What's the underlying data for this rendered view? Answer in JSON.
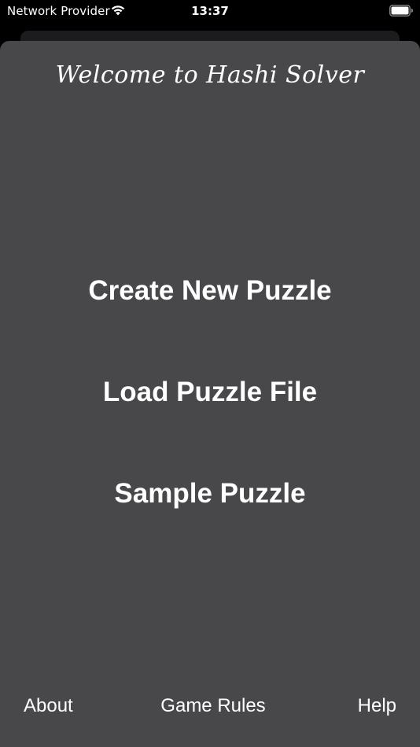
{
  "status_bar": {
    "carrier": "Network Provider",
    "time": "13:37",
    "wifi_icon": "wifi-icon",
    "battery_icon": "battery-icon"
  },
  "title": "Welcome to Hashi Solver",
  "menu": {
    "create_label": "Create New Puzzle",
    "load_label": "Load Puzzle File",
    "sample_label": "Sample Puzzle"
  },
  "footer": {
    "about_label": "About",
    "rules_label": "Game Rules",
    "help_label": "Help"
  },
  "colors": {
    "background": "#000000",
    "sheet": "#48484a",
    "text": "#ffffff"
  }
}
